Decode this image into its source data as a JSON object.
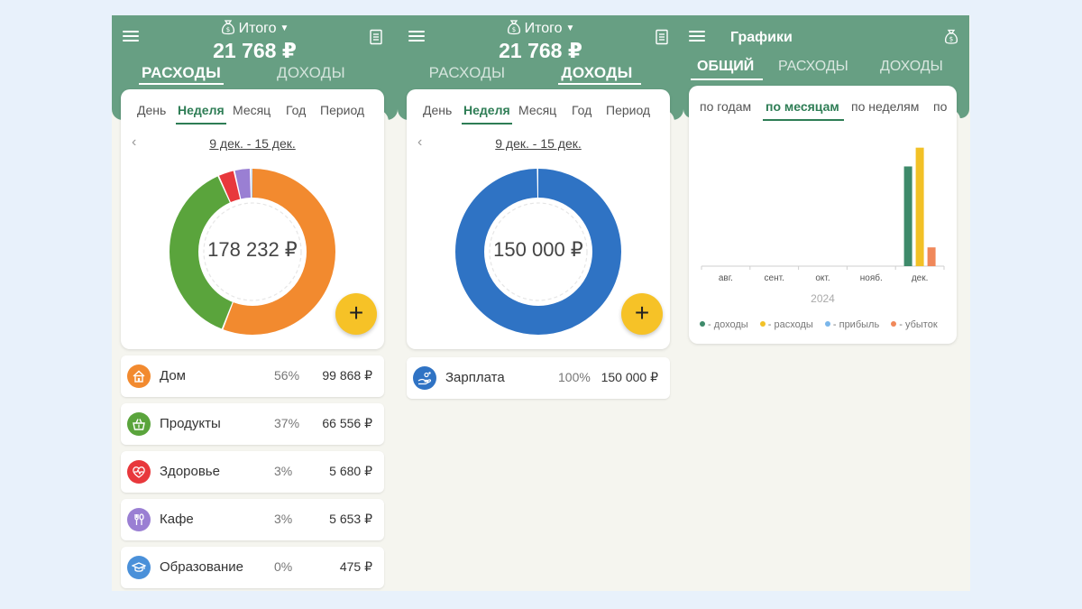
{
  "colors": {
    "header": "#679f83",
    "accent": "#2e7d55",
    "fab": "#f6c227",
    "expense_donut": [
      "#f28a2f",
      "#5aa43c",
      "#e8383c",
      "#9a7fd3",
      "#4a90d9"
    ],
    "income_donut": "#2f73c4",
    "chart_income": "#3e8a6a",
    "chart_expense": "#f2c126",
    "chart_profit": "#7ab6ea",
    "chart_loss": "#f0885a"
  },
  "expenses_screen": {
    "header": {
      "title": "Итого",
      "total": "21 768 ₽",
      "tab_expenses": "РАСХОДЫ",
      "tab_income": "ДОХОДЫ",
      "active_tab": "expenses"
    },
    "periods": [
      "День",
      "Неделя",
      "Месяц",
      "Год",
      "Период"
    ],
    "active_period": "Неделя",
    "range": "9 дек. - 15 дек.",
    "donut_total": "178 232 ₽",
    "fab": "+",
    "categories": [
      {
        "name": "Дом",
        "percent": "56%",
        "amount": "99 868 ₽",
        "value": 99868,
        "color": "#f28a2f",
        "icon": "house-icon"
      },
      {
        "name": "Продукты",
        "percent": "37%",
        "amount": "66 556 ₽",
        "value": 66556,
        "color": "#5aa43c",
        "icon": "basket-icon"
      },
      {
        "name": "Здоровье",
        "percent": "3%",
        "amount": "5 680 ₽",
        "value": 5680,
        "color": "#e8383c",
        "icon": "heart-pulse-icon"
      },
      {
        "name": "Кафе",
        "percent": "3%",
        "amount": "5 653 ₽",
        "value": 5653,
        "color": "#9a7fd3",
        "icon": "fork-spoon-icon"
      },
      {
        "name": "Образование",
        "percent": "0%",
        "amount": "475 ₽",
        "value": 475,
        "color": "#4a90d9",
        "icon": "graduation-cap-icon"
      }
    ]
  },
  "income_screen": {
    "header": {
      "title": "Итого",
      "total": "21 768 ₽",
      "tab_expenses": "РАСХОДЫ",
      "tab_income": "ДОХОДЫ",
      "active_tab": "income"
    },
    "periods": [
      "День",
      "Неделя",
      "Месяц",
      "Год",
      "Период"
    ],
    "active_period": "Неделя",
    "range": "9 дек. - 15 дек.",
    "donut_total": "150 000 ₽",
    "fab": "+",
    "categories": [
      {
        "name": "Зарплата",
        "percent": "100%",
        "amount": "150 000 ₽",
        "value": 150000,
        "color": "#2f73c4",
        "icon": "hand-coins-icon"
      }
    ]
  },
  "charts_screen": {
    "title": "Графики",
    "tabs": [
      "ОБЩИЙ",
      "РАСХОДЫ",
      "ДОХОДЫ"
    ],
    "active_tab": "ОБЩИЙ",
    "chart_tabs": [
      "по годам",
      "по месяцам",
      "по неделям",
      "по"
    ],
    "active_chart_tab": "по месяцам",
    "legend": [
      "- доходы",
      "- расходы",
      "- прибыль",
      "- убыток"
    ]
  },
  "chart_data": {
    "type": "bar",
    "categories": [
      "авг.",
      "сент.",
      "окт.",
      "нояб.",
      "дек."
    ],
    "xlabel": "2024",
    "series": [
      {
        "name": "- доходы",
        "values": [
          0,
          0,
          0,
          0,
          150000
        ]
      },
      {
        "name": "- расходы",
        "values": [
          0,
          0,
          0,
          0,
          178232
        ]
      },
      {
        "name": "- прибыль",
        "values": [
          0,
          0,
          0,
          0,
          0
        ]
      },
      {
        "name": "- убыток",
        "values": [
          0,
          0,
          0,
          0,
          28232
        ]
      }
    ],
    "ylim": [
      0,
      190000
    ],
    "grid": false,
    "legend_position": "bottom"
  }
}
